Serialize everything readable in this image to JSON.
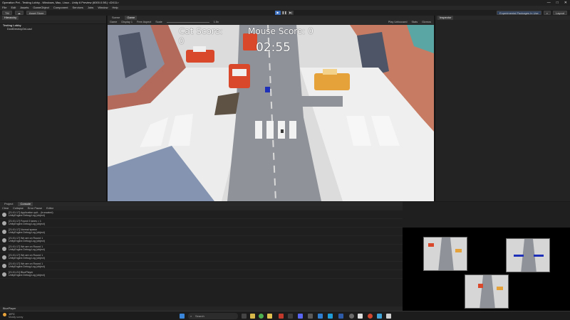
{
  "window": {
    "title": "Operation Pet - Testing Lobby - Windows, Mac, Linux - Unity 6 Preview (6000.0.5f1) <DX11>",
    "controls": [
      "—",
      "□",
      "✕"
    ]
  },
  "menu": [
    "File",
    "Edit",
    "Assets",
    "GameObject",
    "Component",
    "Services",
    "Jobs",
    "Window",
    "Help"
  ],
  "toolbar": {
    "account": "TM",
    "store": "Asset Store",
    "layout_info": "Experimental Packages In Use",
    "layout": "Layout"
  },
  "hierarchy": {
    "tab": "Hierarchy",
    "items": [
      "Testing Lobby",
      "DontDestroyOnLoad"
    ]
  },
  "center_tabs": [
    "Scene",
    "Game"
  ],
  "game_toolbar": {
    "view": "Game",
    "display": "Display 1",
    "aspect": "Free Aspect",
    "scale_label": "Scale",
    "scale_value": "1.5x",
    "play_mode": "Play Unfocused",
    "stats": "Stats",
    "gizmos": "Gizmos"
  },
  "hud": {
    "cat_score_label": "Cat Score:",
    "cat_score_value": "0",
    "mouse_score_label": "Mouse Score: 0",
    "timer": "02:55"
  },
  "inspector": {
    "tab": "Inspector"
  },
  "console": {
    "tabs": [
      "Project",
      "Console"
    ],
    "toolbar": [
      "Clear",
      "Collapse",
      "Error Pause",
      "Editor"
    ],
    "entries": [
      {
        "time": "[21:01:17]",
        "msg": "Application quit... (truncated)",
        "sub": "UnityEngine.Debug:Log (object)"
      },
      {
        "time": "[21:01:17]",
        "msg": "Found 0 lanes = 1",
        "sub": "UnityEngine.Debug:Log (object)"
      },
      {
        "time": "[21:01:17]",
        "msg": "Normal spawn",
        "sub": "UnityEngine.Debug:Log (object)"
      },
      {
        "time": "[21:01:17]",
        "msg": "We are on Round 1",
        "sub": "UnityEngine.Debug:Log (object)"
      },
      {
        "time": "[21:01:17]",
        "msg": "We are on Round 1",
        "sub": "UnityEngine.Debug:Log (object)"
      },
      {
        "time": "[21:01:17]",
        "msg": "We are on Round 1",
        "sub": "UnityEngine.Debug:Log (object)"
      },
      {
        "time": "[21:01:17]",
        "msg": "We are on Round 1",
        "sub": "UnityEngine.Debug:Log (object)"
      },
      {
        "time": "[21:01:21]",
        "msg": "BluePlayer",
        "sub": "UnityEngine.Debug:Log (object)"
      }
    ],
    "status": "BluePlayer"
  },
  "taskbar": {
    "weather_temp": "19°C",
    "weather_desc": "Mostly sunny",
    "search_placeholder": "Search"
  }
}
